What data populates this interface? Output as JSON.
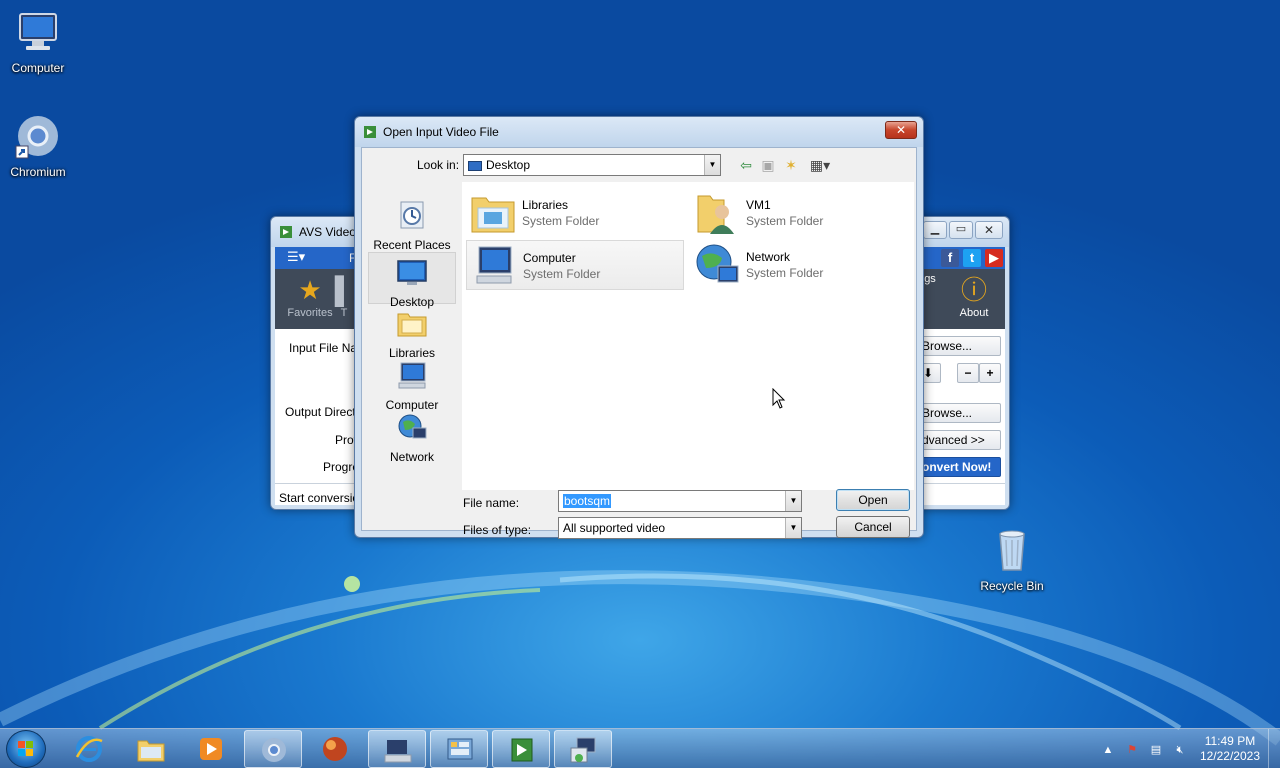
{
  "desktop": {
    "icons": [
      {
        "label": "Computer"
      },
      {
        "label": "Chromium"
      },
      {
        "label": "Recycle Bin"
      }
    ]
  },
  "avs_window": {
    "title": "AVS Video C",
    "menu_partial": "F",
    "tabs": {
      "favorites": "Favorites",
      "t_partial": "T",
      "settings_partial": "gs",
      "about": "About"
    },
    "labels": {
      "input_file": "Input File Nar",
      "output_directory": "Output Directo",
      "profile": "Prof",
      "progress": "Progre",
      "status": "Start conversion"
    },
    "buttons": {
      "browse1": "Browse...",
      "browse2": "Browse...",
      "advanced": "dvanced >>",
      "convert": "onvert Now!",
      "minus": "−",
      "plus": "+"
    }
  },
  "dialog": {
    "title": "Open Input Video File",
    "look_in_label": "Look in:",
    "look_in_value": "Desktop",
    "places": [
      {
        "label": "Recent Places"
      },
      {
        "label": "Desktop"
      },
      {
        "label": "Libraries"
      },
      {
        "label": "Computer"
      },
      {
        "label": "Network"
      }
    ],
    "items": [
      {
        "name": "Libraries",
        "type": "System Folder"
      },
      {
        "name": "VM1",
        "type": "System Folder"
      },
      {
        "name": "Computer",
        "type": "System Folder"
      },
      {
        "name": "Network",
        "type": "System Folder"
      }
    ],
    "file_name_label": "File name:",
    "file_name_value": "bootsqm",
    "files_of_type_label": "Files of type:",
    "files_of_type_value": "All supported video",
    "open_button": "Open",
    "cancel_button": "Cancel"
  },
  "taskbar": {
    "time": "11:49 PM",
    "date": "12/22/2023"
  },
  "colors": {
    "accent": "#3399ff",
    "desktop_blue": "#0c5cb8",
    "avs_toolbar": "#3f4a59",
    "avs_convert": "#2566c8"
  }
}
